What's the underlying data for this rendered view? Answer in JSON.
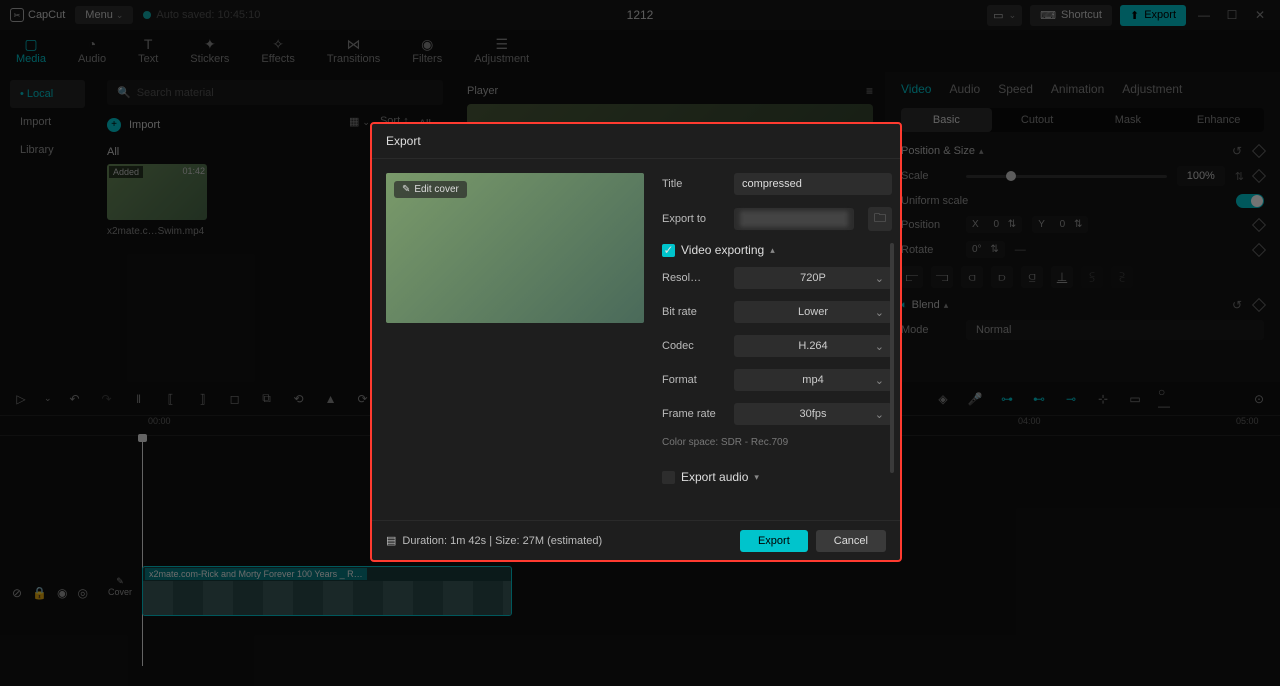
{
  "titlebar": {
    "app": "CapCut",
    "menu": "Menu",
    "autosave": "Auto saved: 10:45:10",
    "project": "1212",
    "shortcut": "Shortcut",
    "export": "Export"
  },
  "tooltabs": [
    "Media",
    "Audio",
    "Text",
    "Stickers",
    "Effects",
    "Transitions",
    "Filters",
    "Adjustment"
  ],
  "tooltabs_active": 0,
  "sidebar": {
    "items": [
      "Local",
      "Import",
      "Library"
    ],
    "active": 0
  },
  "media": {
    "search_placeholder": "Search material",
    "import": "Import",
    "sort": "Sort",
    "all": "All",
    "tab_all": "All",
    "thumb_added": "Added",
    "thumb_dur": "01:42",
    "thumb_name": "x2mate.c…Swim.mp4"
  },
  "player": {
    "title": "Player"
  },
  "inspector": {
    "tabs": [
      "Video",
      "Audio",
      "Speed",
      "Animation",
      "Adjustment"
    ],
    "tabs_active": 0,
    "subtabs": [
      "Basic",
      "Cutout",
      "Mask",
      "Enhance"
    ],
    "subtabs_active": 0,
    "pos_size": "Position & Size",
    "scale": "Scale",
    "scale_val": "100%",
    "uniform": "Uniform scale",
    "position": "Position",
    "x_label": "X",
    "x_val": "0",
    "y_label": "Y",
    "y_val": "0",
    "rotate": "Rotate",
    "rotate_val": "0°",
    "blend": "Blend",
    "mode": "Mode",
    "mode_val": "Normal"
  },
  "timeline": {
    "ticks": [
      "00:00",
      "04:00",
      "05:00"
    ],
    "cover": "Cover",
    "clip_title": "x2mate.com-Rick and Morty Forever 100 Years _ R…"
  },
  "modal": {
    "title": "Export",
    "edit_cover": "Edit cover",
    "fields": {
      "title_label": "Title",
      "title_value": "compressed",
      "export_to_label": "Export to",
      "video_exporting": "Video exporting",
      "resolution_label": "Resol…",
      "resolution_value": "720P",
      "bitrate_label": "Bit rate",
      "bitrate_value": "Lower",
      "codec_label": "Codec",
      "codec_value": "H.264",
      "format_label": "Format",
      "format_value": "mp4",
      "framerate_label": "Frame rate",
      "framerate_value": "30fps",
      "colorspace": "Color space: SDR - Rec.709",
      "export_audio": "Export audio"
    },
    "footer_info": "Duration: 1m 42s | Size: 27M (estimated)",
    "export_btn": "Export",
    "cancel_btn": "Cancel"
  }
}
